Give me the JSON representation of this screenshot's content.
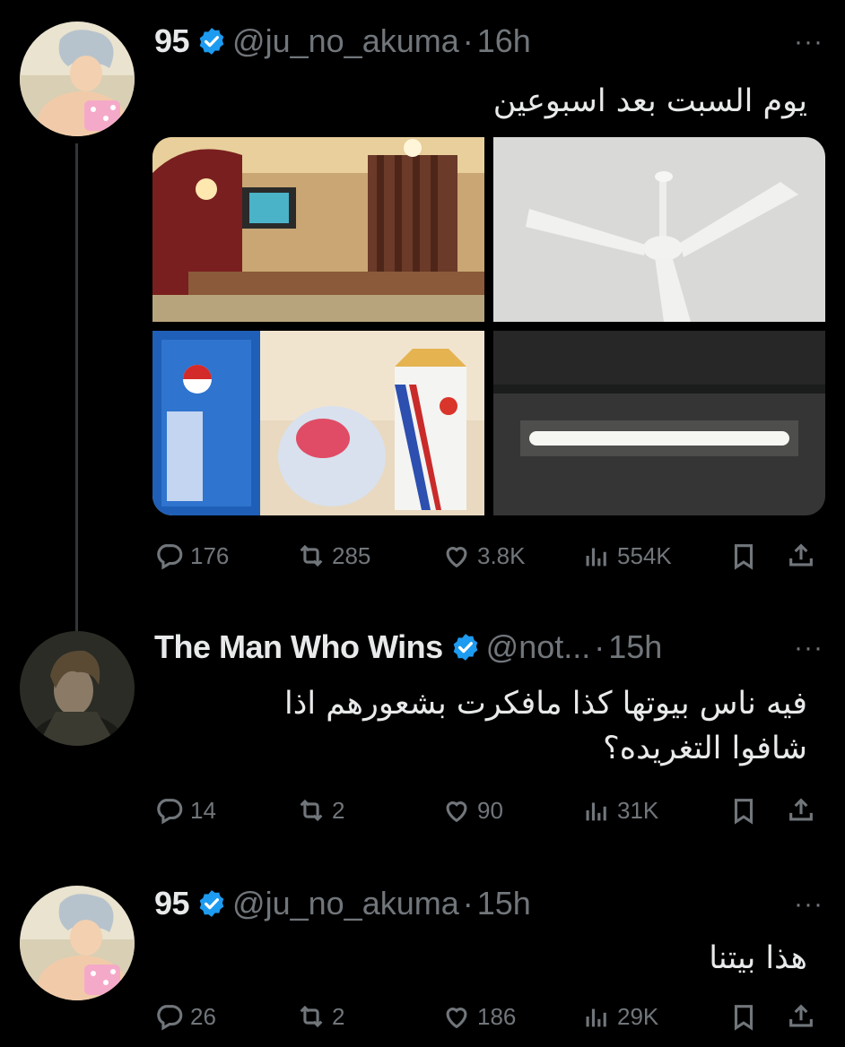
{
  "tweets": [
    {
      "name": "95",
      "handle": "@ju_no_akuma",
      "separator": "·",
      "time": "16h",
      "more": "···",
      "text_lines": [
        "يوم السبت بعد اسبوعين"
      ],
      "media": [
        "room-photo",
        "ceiling-fan-photo",
        "pepsi-fries-meal-photo",
        "fluorescent-light-photo"
      ],
      "stats": {
        "replies": "176",
        "retweets": "285",
        "likes": "3.8K",
        "views": "554K"
      }
    },
    {
      "name": "The Man Who Wins",
      "handle": "@not...",
      "separator": "·",
      "time": "15h",
      "more": "···",
      "text_lines": [
        "فيه ناس بيوتها كذا مافكرت بشعورهم اذا",
        "شافوا التغريده؟"
      ],
      "stats": {
        "replies": "14",
        "retweets": "2",
        "likes": "90",
        "views": "31K"
      }
    },
    {
      "name": "95",
      "handle": "@ju_no_akuma",
      "separator": "·",
      "time": "15h",
      "more": "···",
      "text_lines": [
        "هذا بيتنا"
      ],
      "stats": {
        "replies": "26",
        "retweets": "2",
        "likes": "186",
        "views": "29K"
      }
    }
  ],
  "colors": {
    "background": "#000000",
    "text": "#e7e9ea",
    "secondary": "#71767b",
    "verified": "#1d9bf0"
  },
  "icons": [
    "reply-icon",
    "retweet-icon",
    "like-icon",
    "views-icon",
    "bookmark-icon",
    "share-icon",
    "verified-icon",
    "more-icon"
  ]
}
